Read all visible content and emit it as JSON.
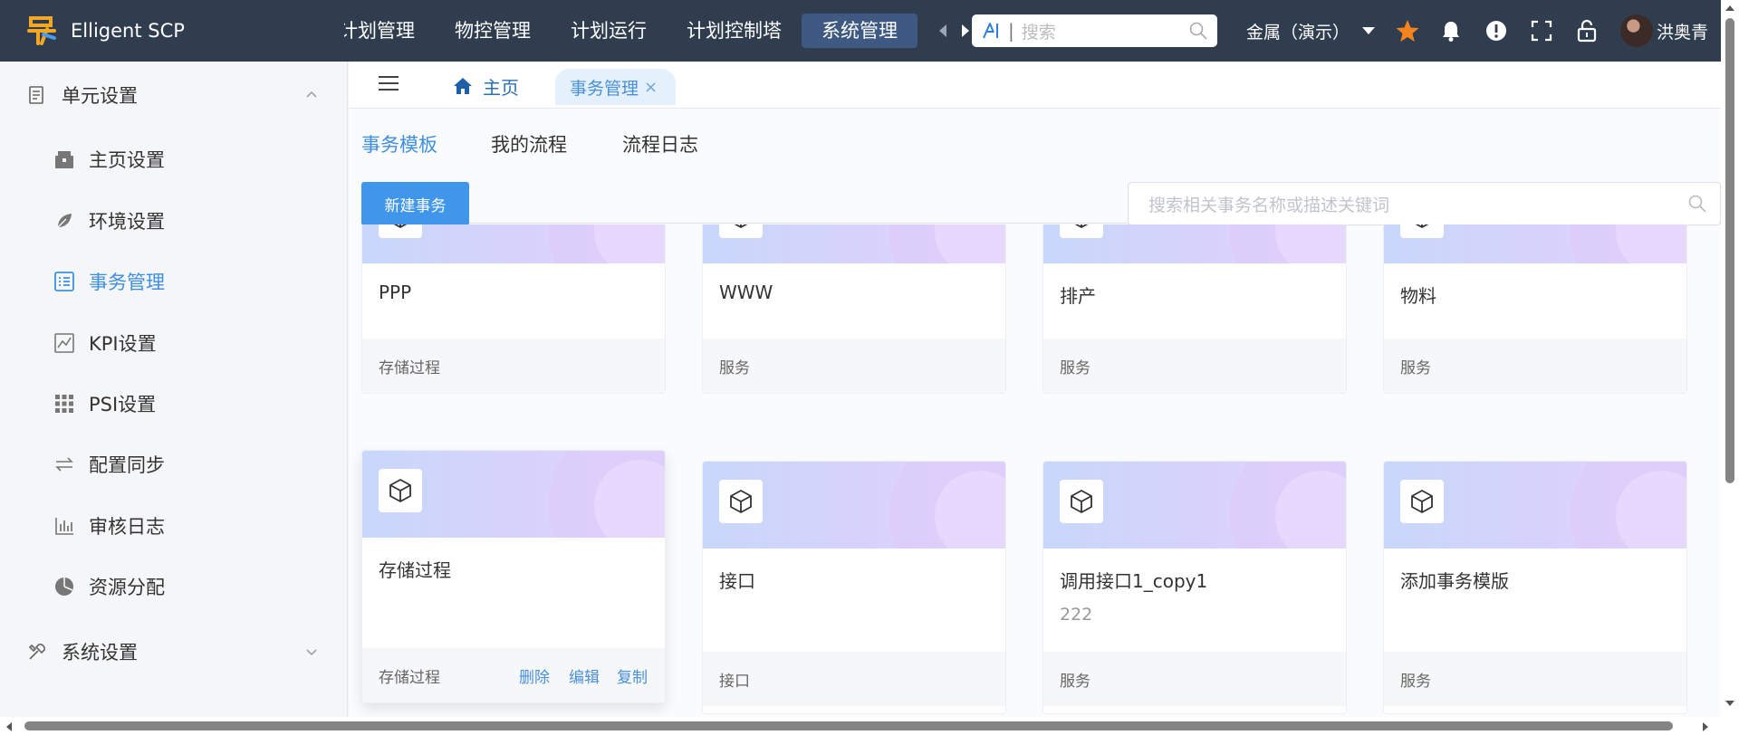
{
  "app": {
    "name": "Elligent SCP"
  },
  "topnav": {
    "items": [
      "计划管理",
      "物控管理",
      "计划运行",
      "计划控制塔",
      "系统管理"
    ],
    "active_index": 4,
    "search_placeholder": "搜索",
    "tenant": "金属（演示）",
    "icons": [
      "star-icon",
      "bell-icon",
      "alert-icon",
      "fullscreen-icon",
      "lock-icon"
    ],
    "user_name": "洪奥青"
  },
  "colors": {
    "topbar": "#2f3d4f",
    "accent": "#3f8fe0",
    "button": "#3f96ea",
    "star": "#f5841f"
  },
  "sidebar": {
    "groups": [
      {
        "label": "单元设置",
        "expanded": true,
        "items": [
          {
            "label": "主页设置",
            "icon": "home-settings-icon"
          },
          {
            "label": "环境设置",
            "icon": "environment-icon"
          },
          {
            "label": "事务管理",
            "icon": "list-icon",
            "active": true
          },
          {
            "label": "KPI设置",
            "icon": "chart-line-icon"
          },
          {
            "label": "PSI设置",
            "icon": "grid-icon"
          },
          {
            "label": "配置同步",
            "icon": "sync-icon"
          },
          {
            "label": "审核日志",
            "icon": "bar-chart-icon"
          },
          {
            "label": "资源分配",
            "icon": "pie-chart-icon"
          }
        ]
      },
      {
        "label": "系统设置",
        "expanded": false,
        "items": []
      }
    ]
  },
  "tabs": {
    "home": "主页",
    "active": "事务管理",
    "close": "×"
  },
  "subtabs": [
    "事务模板",
    "我的流程",
    "流程日志"
  ],
  "toolbar": {
    "new_button": "新建事务",
    "search_placeholder": "搜索相关事务名称或描述关键词"
  },
  "cards": [
    {
      "title": "PPP",
      "desc": "",
      "type": "存储过程"
    },
    {
      "title": "WWW",
      "desc": "",
      "type": "服务"
    },
    {
      "title": "排产",
      "desc": "",
      "type": "服务"
    },
    {
      "title": "物料",
      "desc": "",
      "type": "服务"
    },
    {
      "title": "存储过程",
      "desc": "",
      "type": "存储过程",
      "actions": [
        "删除",
        "编辑",
        "复制"
      ]
    },
    {
      "title": "接口",
      "desc": "",
      "type": "接口"
    },
    {
      "title": "调用接口1_copy1",
      "desc": "222",
      "type": "服务"
    },
    {
      "title": "添加事务模版",
      "desc": "",
      "type": "服务"
    }
  ]
}
